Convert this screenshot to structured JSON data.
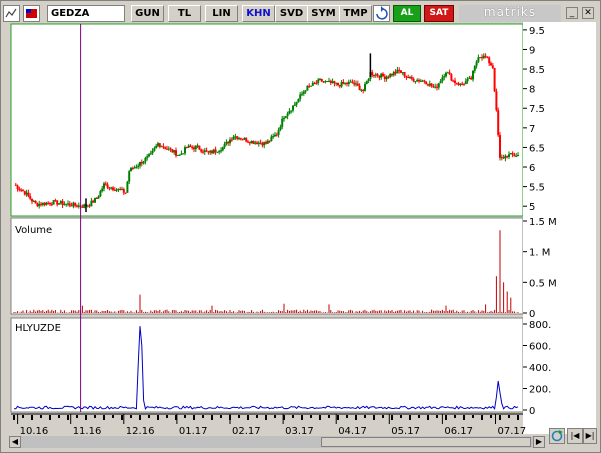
{
  "toolbar": {
    "symbol": "GEDZA",
    "period_buttons": [
      "GUN",
      "TL",
      "LIN",
      "KHN",
      "SVD",
      "SYM",
      "TMP"
    ],
    "active_button": "KHN",
    "buy_label": "AL",
    "sell_label": "SAT",
    "logo": "matriks",
    "colors": {
      "buy": "#18a018",
      "sell": "#d01818",
      "active_text": "#1010d0"
    }
  },
  "panels": {
    "price_label": "",
    "volume_label": "Volume",
    "indicator_label": "HLYUZDE"
  },
  "colors": {
    "up": "#008000",
    "down": "#ff0000",
    "volume": "#c00000",
    "indicator": "#0000c0",
    "cursor": "#800080",
    "border_green": "#20a020"
  },
  "chart_data": [
    {
      "type": "candlestick",
      "title": "",
      "yticks": [
        5,
        5.5,
        6,
        6.5,
        7,
        7.5,
        8,
        8.5,
        9,
        9.5
      ],
      "ylim": [
        4.75,
        9.65
      ],
      "x_labels": [
        "10.16",
        "11.16",
        "12.16",
        "01.17",
        "02.17",
        "03.17",
        "04.17",
        "05.17",
        "06.17",
        "07.17"
      ],
      "cursor_x": "11.16",
      "anchors": [
        {
          "d": 0,
          "v": 5.55
        },
        {
          "d": 6,
          "v": 5.35
        },
        {
          "d": 12,
          "v": 5.05
        },
        {
          "d": 22,
          "v": 5.1
        },
        {
          "d": 30,
          "v": 5.05
        },
        {
          "d": 38,
          "v": 5.0
        },
        {
          "d": 42,
          "v": 5.05
        },
        {
          "d": 46,
          "v": 5.2
        },
        {
          "d": 50,
          "v": 5.55
        },
        {
          "d": 56,
          "v": 5.45
        },
        {
          "d": 62,
          "v": 5.35
        },
        {
          "d": 64,
          "v": 5.9
        },
        {
          "d": 70,
          "v": 6.1
        },
        {
          "d": 76,
          "v": 6.3
        },
        {
          "d": 80,
          "v": 6.6
        },
        {
          "d": 86,
          "v": 6.45
        },
        {
          "d": 92,
          "v": 6.3
        },
        {
          "d": 96,
          "v": 6.5
        },
        {
          "d": 102,
          "v": 6.5
        },
        {
          "d": 108,
          "v": 6.35
        },
        {
          "d": 116,
          "v": 6.5
        },
        {
          "d": 122,
          "v": 6.8
        },
        {
          "d": 132,
          "v": 6.65
        },
        {
          "d": 140,
          "v": 6.6
        },
        {
          "d": 146,
          "v": 6.85
        },
        {
          "d": 150,
          "v": 7.3
        },
        {
          "d": 156,
          "v": 7.6
        },
        {
          "d": 162,
          "v": 8.0
        },
        {
          "d": 170,
          "v": 8.2
        },
        {
          "d": 180,
          "v": 8.1
        },
        {
          "d": 188,
          "v": 8.15
        },
        {
          "d": 194,
          "v": 7.95
        },
        {
          "d": 198,
          "v": 8.4
        },
        {
          "d": 206,
          "v": 8.3
        },
        {
          "d": 214,
          "v": 8.45
        },
        {
          "d": 220,
          "v": 8.25
        },
        {
          "d": 228,
          "v": 8.2
        },
        {
          "d": 234,
          "v": 8.0
        },
        {
          "d": 240,
          "v": 8.45
        },
        {
          "d": 244,
          "v": 8.2
        },
        {
          "d": 248,
          "v": 8.1
        },
        {
          "d": 254,
          "v": 8.25
        },
        {
          "d": 258,
          "v": 8.85
        },
        {
          "d": 262,
          "v": 8.8
        },
        {
          "d": 266,
          "v": 8.55
        },
        {
          "d": 268,
          "v": 7.4
        },
        {
          "d": 270,
          "v": 6.2
        },
        {
          "d": 274,
          "v": 6.3
        }
      ]
    },
    {
      "type": "bar",
      "title": "Volume",
      "yticks": [
        "0",
        "0.5 M",
        "1. M",
        "1.5 M"
      ],
      "ylim": [
        0,
        1.5
      ]
    },
    {
      "type": "line",
      "title": "HLYUZDE",
      "yticks": [
        "0",
        "200.",
        "400.",
        "600.",
        "800."
      ],
      "ylim": [
        0,
        800
      ]
    }
  ]
}
